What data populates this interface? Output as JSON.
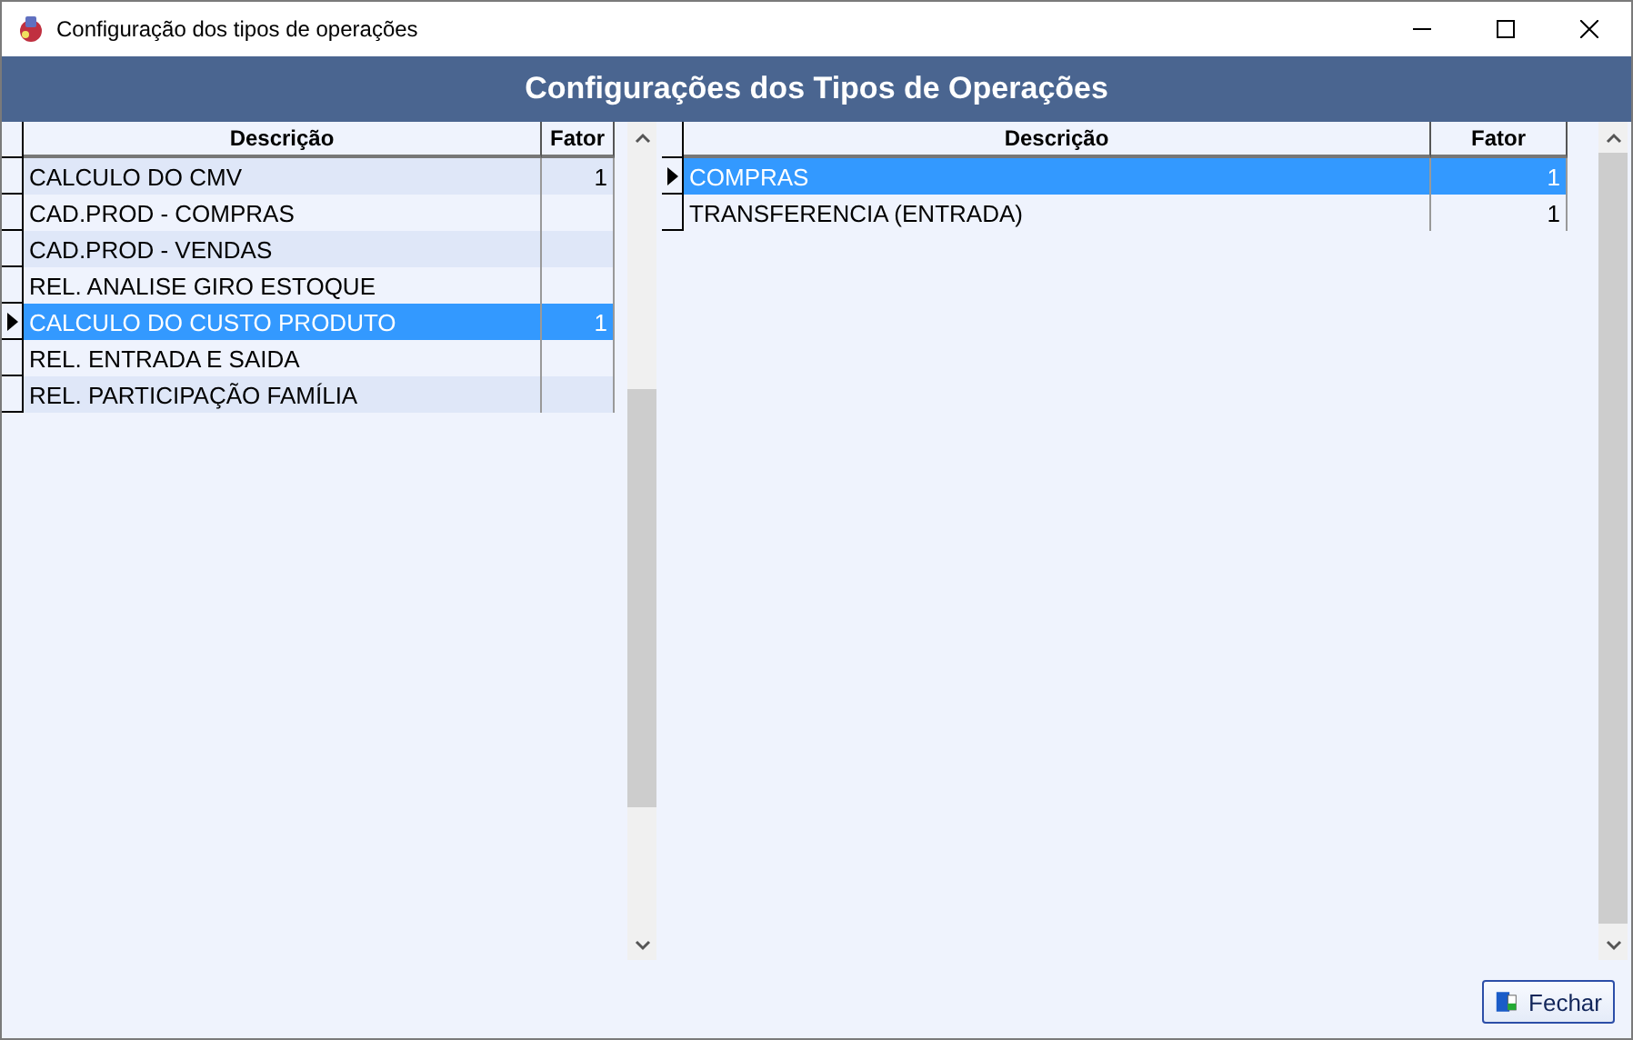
{
  "window": {
    "title": "Configuração dos tipos de operações"
  },
  "header": {
    "title": "Configurações dos Tipos de Operações"
  },
  "left_grid": {
    "columns": [
      "Descrição",
      "Fator"
    ],
    "rows": [
      {
        "descricao": "CALCULO DO CMV",
        "fator": "1",
        "selected": false
      },
      {
        "descricao": "CAD.PROD - COMPRAS",
        "selected": false
      },
      {
        "descricao": "CAD.PROD - VENDAS",
        "selected": false
      },
      {
        "descricao": "REL. ANALISE GIRO ESTOQUE",
        "selected": false
      },
      {
        "descricao": "CALCULO DO CUSTO PRODUTO",
        "fator": "1",
        "selected": true
      },
      {
        "descricao": "REL. ENTRADA E SAIDA",
        "selected": false
      },
      {
        "descricao": "REL. PARTICIPAÇÃO FAMÍLIA",
        "selected": false
      }
    ]
  },
  "right_grid": {
    "columns": [
      "Descrição",
      "Fator"
    ],
    "rows": [
      {
        "descricao": "COMPRAS",
        "fator": "1",
        "selected": true
      },
      {
        "descricao": "TRANSFERENCIA (ENTRADA)",
        "fator": "1",
        "selected": false
      }
    ]
  },
  "buttons": [
    "Fechar"
  ]
}
